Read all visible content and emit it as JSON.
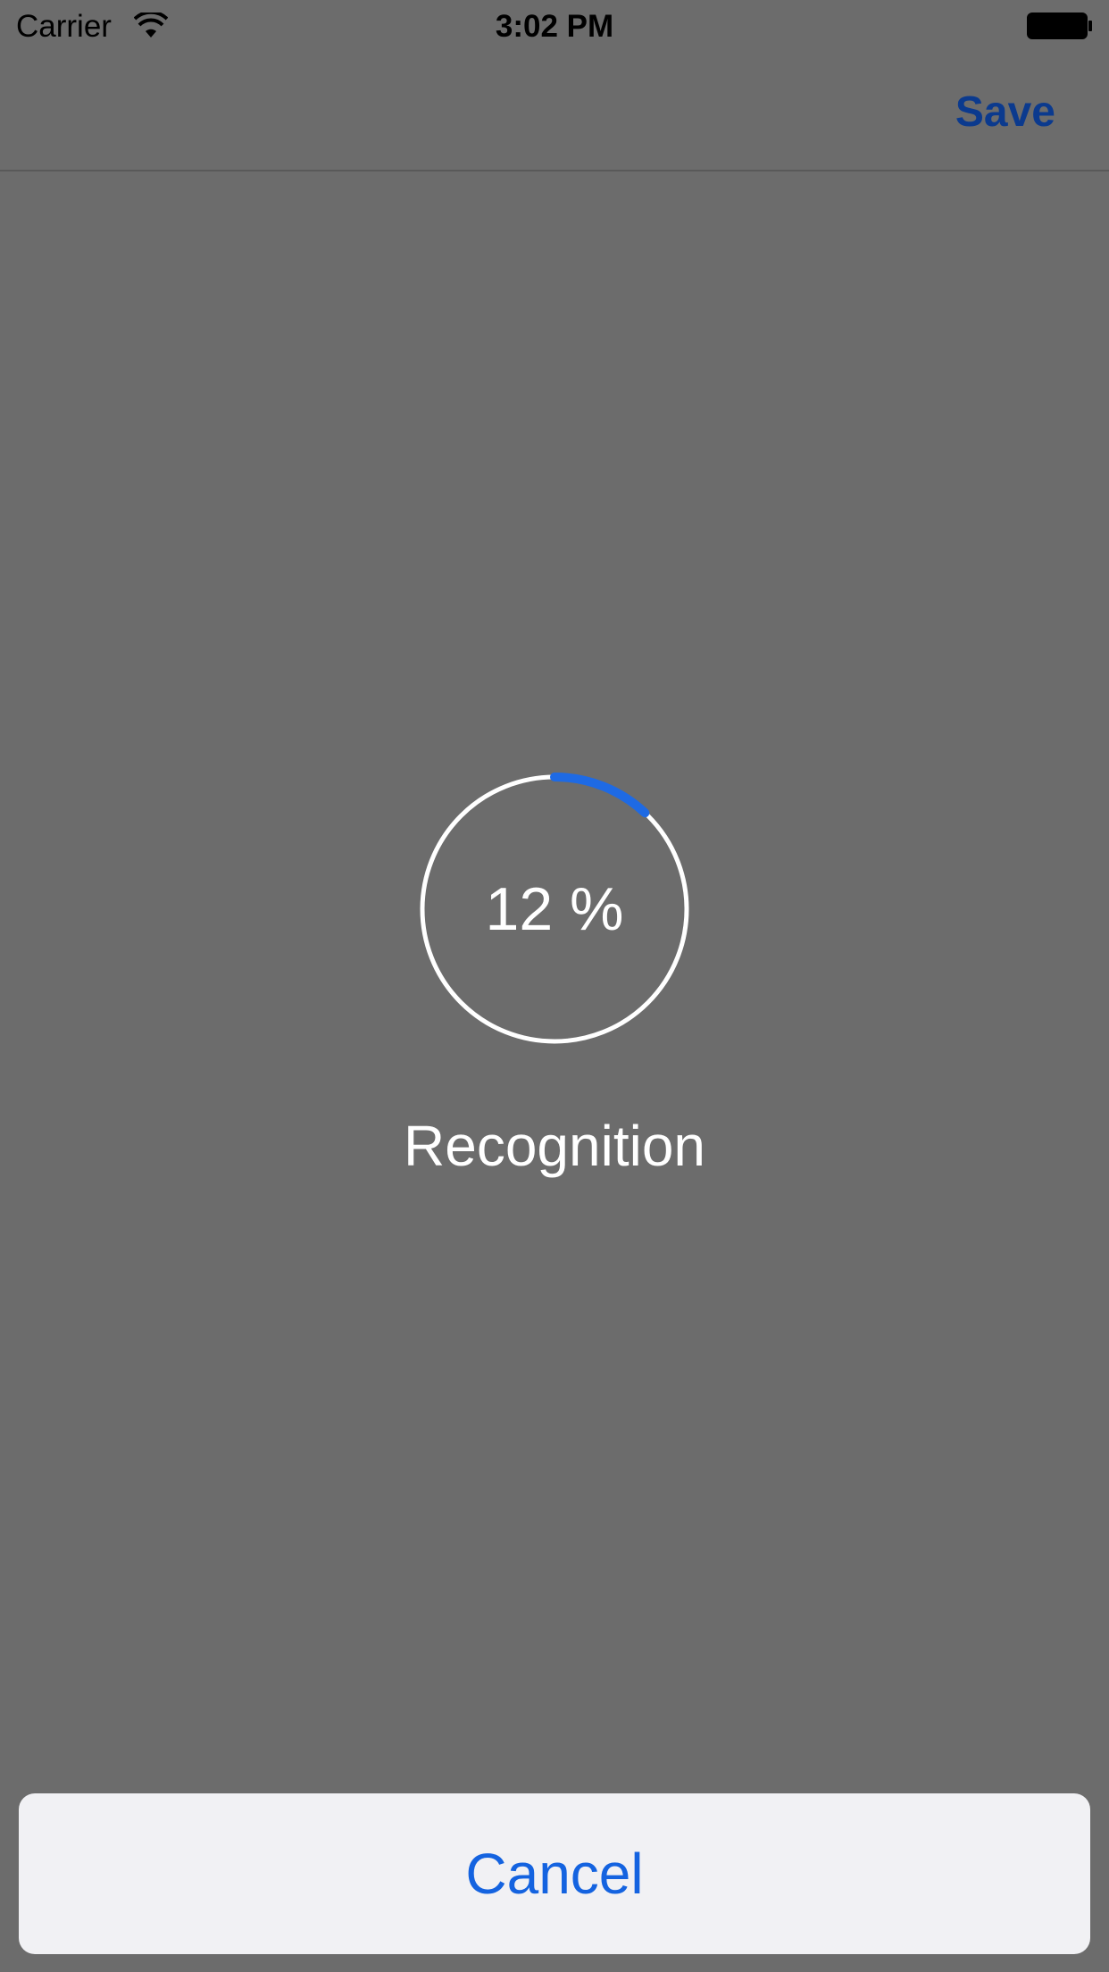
{
  "status_bar": {
    "carrier": "Carrier",
    "time": "3:02 PM",
    "wifi_icon": "wifi-icon",
    "battery_icon": "battery-icon"
  },
  "nav": {
    "save_label": "Save"
  },
  "progress": {
    "value_text": "12 %",
    "fraction": 0.12,
    "label": "Recognition",
    "arc_color": "#1e6ae4",
    "track_color": "#ffffff"
  },
  "cancel": {
    "label": "Cancel"
  },
  "colors": {
    "background": "#6c6c6c",
    "accent": "#1463e0",
    "save": "#0b3a8e"
  }
}
